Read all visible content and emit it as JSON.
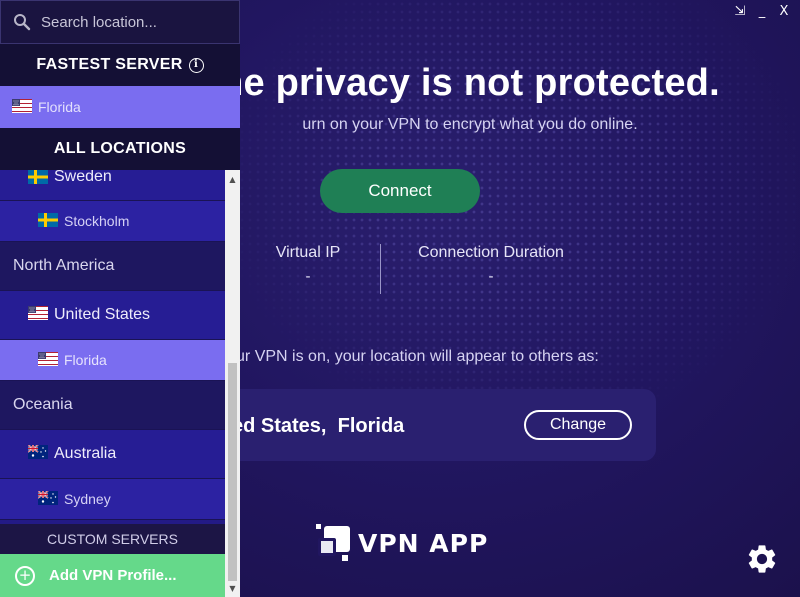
{
  "window": {
    "restore": "⇲",
    "minimize": "_",
    "close": "X"
  },
  "main": {
    "headline": "ne privacy is not protected.",
    "subline": "urn on your VPN to encrypt what you do online.",
    "connect_label": "Connect",
    "stats": {
      "virtual_ip_label": "Virtual IP",
      "virtual_ip_value": "-",
      "duration_label": "Connection Duration",
      "duration_value": "-"
    },
    "location_note": "our VPN is on, your location will appear to others as:",
    "location_country": "ed States,",
    "location_city": "Florida",
    "change_label": "Change",
    "logo_text": "VPN APP",
    "settings_icon": "gear-icon"
  },
  "sidebar": {
    "search_placeholder": "Search location...",
    "fastest_header": "FASTEST SERVER",
    "fastest_server": {
      "label": "Florida",
      "flag": "us"
    },
    "all_locations_header": "ALL LOCATIONS",
    "locations": [
      {
        "type": "country",
        "label": "Sweden",
        "flag": "se"
      },
      {
        "type": "city",
        "label": "Stockholm",
        "flag": "se"
      },
      {
        "type": "region",
        "label": "North America"
      },
      {
        "type": "country",
        "label": "United States",
        "flag": "us"
      },
      {
        "type": "city",
        "label": "Florida",
        "flag": "us",
        "selected": true
      },
      {
        "type": "region",
        "label": "Oceania"
      },
      {
        "type": "country",
        "label": "Australia",
        "flag": "au"
      },
      {
        "type": "city",
        "label": "Sydney",
        "flag": "au"
      }
    ],
    "custom_servers_label": "CUSTOM SERVERS",
    "add_profile_label": "Add VPN Profile...",
    "scroll": {
      "up": "▲",
      "down": "▼"
    }
  },
  "colors": {
    "background": "#211660",
    "sidebar": "#1c1545",
    "selected": "#7a6df0",
    "connect": "#1f7f55",
    "add_profile": "#65d98a"
  }
}
